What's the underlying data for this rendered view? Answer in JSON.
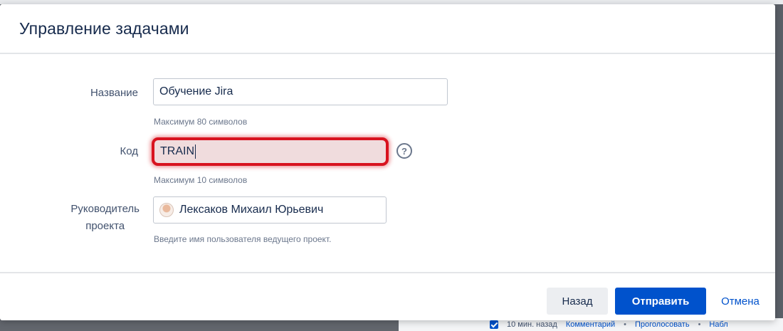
{
  "dialog": {
    "title": "Управление задачами"
  },
  "form": {
    "name": {
      "label": "Название",
      "value": "Обучение Jira",
      "hint": "Максимум 80 символов"
    },
    "code": {
      "label": "Код",
      "value": "TRAIN",
      "hint": "Максимум 10 символов",
      "help_icon": "question-circle-icon",
      "highlight_color": "#d8131f"
    },
    "lead": {
      "label_line1": "Руководитель",
      "label_line2": "проекта",
      "value": "Лексаков Михаил Юрьевич",
      "hint": "Введите имя пользователя ведущего проект.",
      "avatar_icon": "user-avatar-icon"
    }
  },
  "footer": {
    "back_label": "Назад",
    "submit_label": "Отправить",
    "cancel_label": "Отмена",
    "accent_color": "#0052cc"
  },
  "background": {
    "time_ago": "10 мин. назад",
    "comment_link": "Комментарий",
    "vote_link": "Проголосовать",
    "watch_link": "Набл"
  }
}
